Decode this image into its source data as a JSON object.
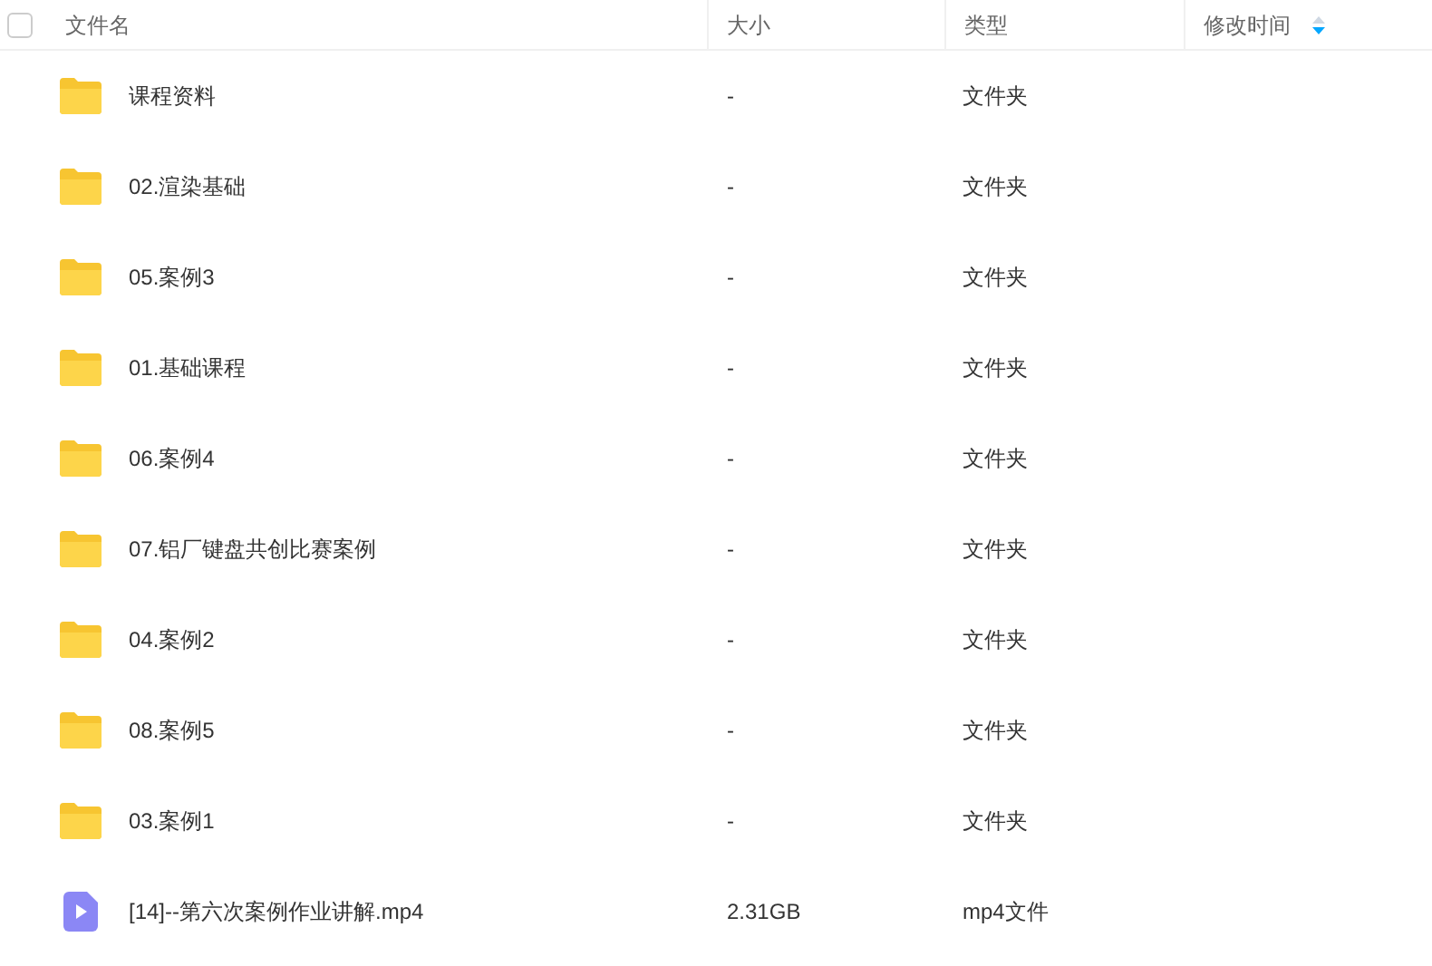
{
  "header": {
    "checked": false,
    "columns": [
      "文件名",
      "大小",
      "类型",
      "修改时间"
    ]
  },
  "rows": [
    {
      "kind": "folder",
      "name": "课程资料",
      "size": "-",
      "type": "文件夹"
    },
    {
      "kind": "folder",
      "name": "02.渲染基础",
      "size": "-",
      "type": "文件夹"
    },
    {
      "kind": "folder",
      "name": "05.案例3",
      "size": "-",
      "type": "文件夹"
    },
    {
      "kind": "folder",
      "name": "01.基础课程",
      "size": "-",
      "type": "文件夹"
    },
    {
      "kind": "folder",
      "name": "06.案例4",
      "size": "-",
      "type": "文件夹"
    },
    {
      "kind": "folder",
      "name": "07.铝厂键盘共创比赛案例",
      "size": "-",
      "type": "文件夹"
    },
    {
      "kind": "folder",
      "name": "04.案例2",
      "size": "-",
      "type": "文件夹"
    },
    {
      "kind": "folder",
      "name": "08.案例5",
      "size": "-",
      "type": "文件夹"
    },
    {
      "kind": "folder",
      "name": "03.案例1",
      "size": "-",
      "type": "文件夹"
    },
    {
      "kind": "video",
      "name": "[14]--第六次案例作业讲解.mp4",
      "size": "2.31GB",
      "type": "mp4文件"
    }
  ]
}
